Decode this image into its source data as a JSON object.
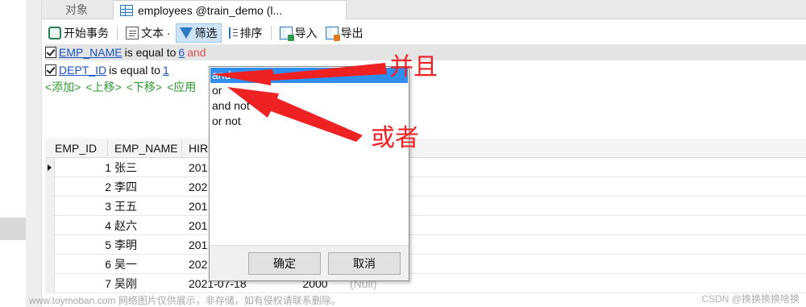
{
  "tabs": {
    "inactive_label": "对象",
    "active_label": "employees @train_demo (l..."
  },
  "toolbar": {
    "begin_tx": "开始事务",
    "text": "文本 ·",
    "filter": "筛选",
    "sort": "排序",
    "import": "导入",
    "export": "导出"
  },
  "filter": {
    "row1": {
      "field": "EMP_NAME",
      "op": "is equal to",
      "value": "6",
      "connector": "and"
    },
    "row2": {
      "field": "DEPT_ID",
      "op": "is equal to",
      "value": "1"
    },
    "actions": [
      "<添加>",
      "<上移>",
      "<下移>",
      "<应用"
    ]
  },
  "table": {
    "columns": [
      "EMP_ID",
      "EMP_NAME",
      "HIR"
    ],
    "rows": [
      {
        "id": "1",
        "name": "张三",
        "hire": "201"
      },
      {
        "id": "2",
        "name": "李四",
        "hire": "202"
      },
      {
        "id": "3",
        "name": "王五",
        "hire": "201"
      },
      {
        "id": "4",
        "name": "赵六",
        "hire": "201"
      },
      {
        "id": "5",
        "name": "李明",
        "hire": "201"
      },
      {
        "id": "6",
        "name": "吴一",
        "hire": "202"
      },
      {
        "id": "7",
        "name": "吴刚",
        "hire": "2021-07-18",
        "salary": "2000",
        "extra": "(Null)"
      }
    ]
  },
  "dropdown": {
    "options": [
      "and",
      "or",
      "and not",
      "or not"
    ],
    "selected": "and",
    "ok_label": "确定",
    "cancel_label": "取消"
  },
  "annotations": {
    "and_label": "并且",
    "or_label": "或者",
    "color": "#ee2222"
  },
  "watermark": "www.toymoban.com 网络图片仅供展示，非存储，如有侵权请联系删除。",
  "credit": "CSDN @换换换换啥换"
}
